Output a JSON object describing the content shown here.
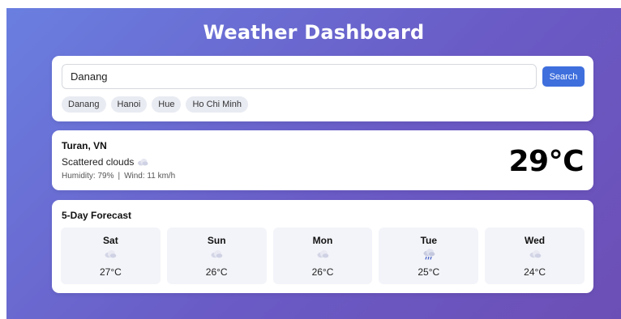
{
  "header": {
    "title": "Weather Dashboard"
  },
  "search": {
    "value": "Danang",
    "button_label": "Search",
    "chips": [
      "Danang",
      "Hanoi",
      "Hue",
      "Ho Chi Minh"
    ]
  },
  "current": {
    "location": "Turan, VN",
    "description": "Scattered clouds",
    "icon": "cloud-icon",
    "humidity": "Humidity: 79%",
    "separator": "|",
    "wind": "Wind: 11 km/h",
    "temperature": "29°C"
  },
  "forecast": {
    "title": "5-Day Forecast",
    "days": [
      {
        "name": "Sat",
        "icon": "cloud-icon",
        "temp": "27°C"
      },
      {
        "name": "Sun",
        "icon": "cloud-icon",
        "temp": "26°C"
      },
      {
        "name": "Mon",
        "icon": "cloud-icon",
        "temp": "26°C"
      },
      {
        "name": "Tue",
        "icon": "rain-cloud-icon",
        "temp": "25°C"
      },
      {
        "name": "Wed",
        "icon": "cloud-icon",
        "temp": "24°C"
      }
    ]
  },
  "colors": {
    "accent": "#3f6fdd",
    "gradient_start": "#6a7fe0",
    "gradient_end": "#6c4fb6"
  }
}
